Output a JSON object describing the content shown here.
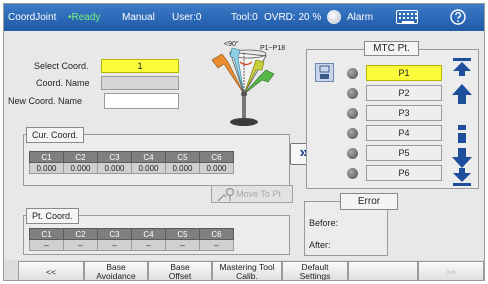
{
  "status_bar": {
    "program": "CoordJoint",
    "state": "Ready",
    "mode": "Manual",
    "user": "User:0",
    "tool": "Tool:0",
    "ovrd": "OVRD: 20 %",
    "alarm": "Alarm"
  },
  "coord_select": {
    "select_label": "Select Coord.",
    "select_value": "1",
    "name_label": "Coord. Name",
    "name_value": "",
    "new_name_label": "New Coord. Name",
    "new_name_value": ""
  },
  "robot_image": {
    "angle_label": "<90°",
    "range_label": "P1~P18"
  },
  "cur_coord": {
    "title": "Cur. Coord.",
    "headers": [
      "C1",
      "C2",
      "C3",
      "C4",
      "C5",
      "C6"
    ],
    "values": [
      "0.000",
      "0.000",
      "0.000",
      "0.000",
      "0.000",
      "0.000"
    ]
  },
  "transfer_button": "»",
  "move_to_pt": "Move To Pt",
  "pt_coord": {
    "title": "Pt. Coord.",
    "headers": [
      "C1",
      "C2",
      "C3",
      "C4",
      "C5",
      "C6"
    ],
    "values": [
      "–",
      "–",
      "–",
      "–",
      "–",
      "–"
    ]
  },
  "mtc": {
    "title": "MTC Pt.",
    "points": [
      "P1",
      "P2",
      "P3",
      "P4",
      "P5",
      "P6"
    ],
    "selected": "P1"
  },
  "error": {
    "title": "Error",
    "before_label": "Before:",
    "after_label": "After:"
  },
  "bottom_bar": {
    "prev": "<<",
    "base_avoidance": [
      "Base",
      "Avoidance"
    ],
    "base_offset": [
      "Base",
      "Offset"
    ],
    "mastering_tool": [
      "Mastering Tool",
      "Calib."
    ],
    "default_settings": [
      "Default",
      "Settings"
    ],
    "next": ">>"
  },
  "colors": {
    "status_bar": "#2a66b4",
    "ready": "#7cf07c",
    "selected": "#fbfb3c",
    "accent_arrow": "#1b3f86"
  }
}
